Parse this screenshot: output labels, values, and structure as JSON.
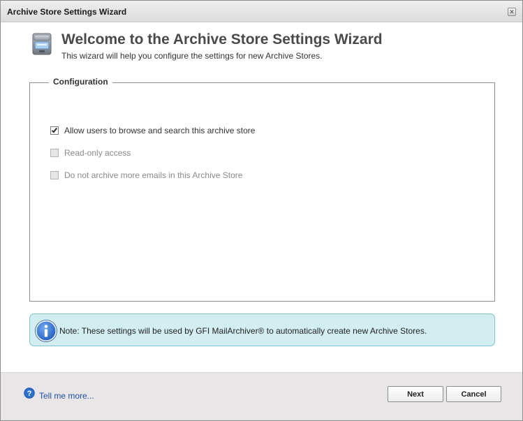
{
  "window": {
    "title": "Archive Store Settings Wizard",
    "close_symbol": "✕"
  },
  "header": {
    "icon": "archive-store-icon",
    "title": "Welcome to the Archive Store Settings Wizard",
    "subtitle": "This wizard will help you configure the settings for new Archive Stores."
  },
  "configuration": {
    "legend": "Configuration",
    "options": [
      {
        "label": "Allow users to browse and search this archive store",
        "checked": true,
        "enabled": true
      },
      {
        "label": "Read-only access",
        "checked": false,
        "enabled": false
      },
      {
        "label": "Do not archive more emails in this Archive Store",
        "checked": false,
        "enabled": false
      }
    ]
  },
  "note": {
    "icon": "info-icon",
    "text": "Note: These settings will be used by GFI MailArchiver® to automatically create new Archive Stores."
  },
  "footer": {
    "help_icon": "help-icon",
    "help_link": "Tell me more...",
    "next_label": "Next",
    "cancel_label": "Cancel"
  },
  "colors": {
    "note_background": "#d3eef0",
    "note_border": "#7fc2c7",
    "link": "#1f4fa3",
    "info_blue": "#2b6fd0"
  }
}
